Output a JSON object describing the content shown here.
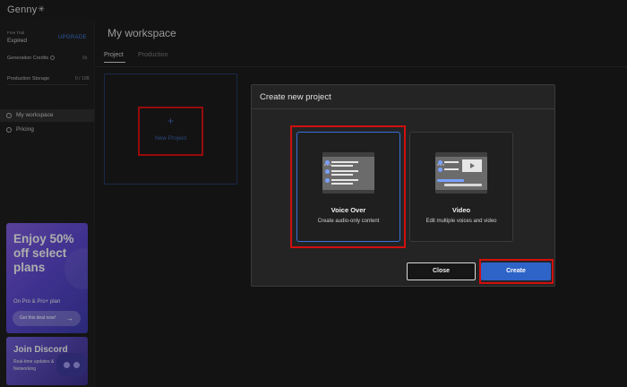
{
  "app": {
    "brand": "Genny",
    "brand_mark": "✳"
  },
  "sidebar": {
    "trial_label": "Free Trial",
    "trial_status": "Expired",
    "upgrade_label": "UPGRADE",
    "generation_credits_label": "Generation Credits",
    "generation_credits_value": "0s",
    "production_storage_label": "Production Storage",
    "production_storage_value": "0 / 10B",
    "nav": [
      {
        "label": "My workspace",
        "icon": "home-icon",
        "active": true
      },
      {
        "label": "Pricing",
        "icon": "dollar-icon",
        "active": false
      }
    ],
    "promo": {
      "title": "Enjoy 50% off select plans",
      "subtitle": "On Pro & Pro+ plan",
      "button_label": "Get this deal now!",
      "button_arrow": "→"
    },
    "discord": {
      "title": "Join Discord",
      "subtitle": "Real-time updates & Networking"
    }
  },
  "main": {
    "page_title": "My workspace",
    "tabs": [
      {
        "label": "Project",
        "active": true
      },
      {
        "label": "Production",
        "active": false
      }
    ],
    "new_project": {
      "plus": "+",
      "label": "New Project"
    }
  },
  "modal": {
    "title": "Create new project",
    "options": [
      {
        "name": "Voice Over",
        "description": "Create audio-only content",
        "selected": true
      },
      {
        "name": "Video",
        "description": "Edit multiple voices and video",
        "selected": false
      }
    ],
    "close_label": "Close",
    "create_label": "Create"
  },
  "colors": {
    "accent": "#2e63c8",
    "highlight_red": "#d10f0f",
    "background": "#1b1b1b"
  }
}
